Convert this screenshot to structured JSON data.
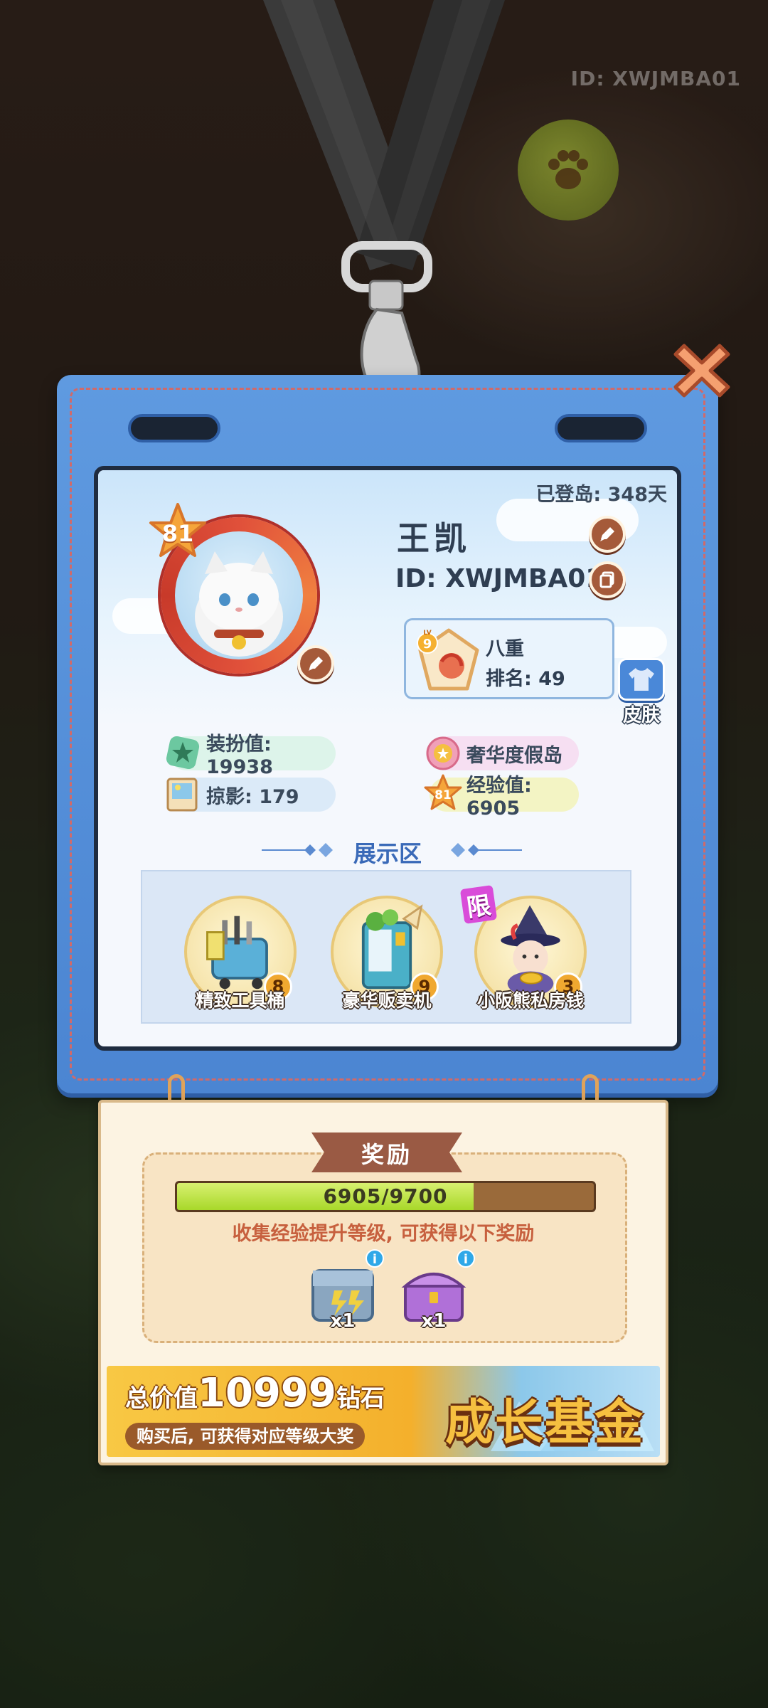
{
  "background": {
    "watermark_id": "ID: XWJMBA01"
  },
  "card": {
    "days_label": "已登岛: 348天",
    "avatar_level": "81",
    "player_name": "王凯",
    "player_id": "ID: XWJMBA01",
    "rank": {
      "level_badge": "9",
      "level_prefix": "LV",
      "title": "八重",
      "rank_label": "排名: 49"
    },
    "skin_label": "皮肤",
    "stats": {
      "dress_value": "装扮值: 19938",
      "photo": "掠影: 179",
      "island": "奢华度假岛",
      "exp_badge": "81",
      "exp_value": "经验值: 6905"
    },
    "display_title": "展示区",
    "display_items": [
      {
        "name": "精致工具桶",
        "count": "8"
      },
      {
        "name": "豪华贩卖机",
        "count": "9"
      },
      {
        "name": "小阪熊私房钱",
        "count": "3",
        "tag": "限"
      }
    ]
  },
  "reward": {
    "title": "奖励",
    "progress_text": "6905/9700",
    "progress_fraction": 0.712,
    "hint": "收集经验提升等级, 可获得以下奖励",
    "gifts": [
      {
        "icon": "gear-box-icon",
        "qty": "x1",
        "info": "i"
      },
      {
        "icon": "purple-chest-icon",
        "qty": "x1",
        "info": "i"
      }
    ],
    "banner": {
      "prefix": "总价值",
      "amount": "10999",
      "suffix": "钻石",
      "subtitle": "购买后, 可获得对应等级大奖",
      "fund": "成长基金"
    }
  },
  "colors": {
    "card_blue": "#4b85d2",
    "accent_red": "#e0503a",
    "progress_green": "#a8d82a"
  }
}
